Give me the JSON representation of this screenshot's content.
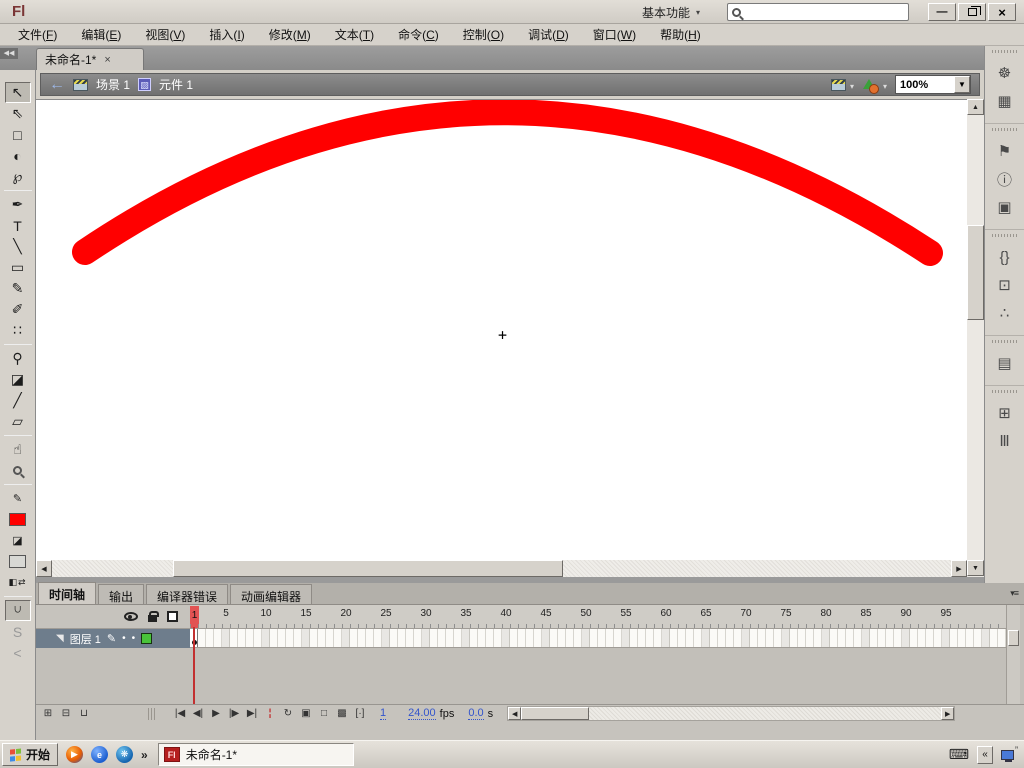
{
  "titlebar": {
    "logo": "Fl",
    "workspace": "基本功能",
    "dropdown_arrow": "▾",
    "search_value": "",
    "window_controls": {
      "minimize": "—",
      "close": "×"
    }
  },
  "menu": {
    "items": [
      {
        "label": "文件",
        "mnemonic": "F"
      },
      {
        "label": "编辑",
        "mnemonic": "E"
      },
      {
        "label": "视图",
        "mnemonic": "V"
      },
      {
        "label": "插入",
        "mnemonic": "I"
      },
      {
        "label": "修改",
        "mnemonic": "M"
      },
      {
        "label": "文本",
        "mnemonic": "T"
      },
      {
        "label": "命令",
        "mnemonic": "C"
      },
      {
        "label": "控制",
        "mnemonic": "O"
      },
      {
        "label": "调试",
        "mnemonic": "D"
      },
      {
        "label": "窗口",
        "mnemonic": "W"
      },
      {
        "label": "帮助",
        "mnemonic": "H"
      }
    ]
  },
  "doc_tab": {
    "label": "未命名-1*",
    "close": "×",
    "collapse": "◀◀"
  },
  "edit_bar": {
    "back_arrow": "←",
    "scene_label": "场景 1",
    "symbol_label": "元件 1",
    "zoom_value": "100%",
    "zoom_dropdown": "▼"
  },
  "toolbar": {
    "tools": [
      {
        "name": "selection-tool",
        "glyph": "↖",
        "selected": true
      },
      {
        "name": "subselection-tool",
        "glyph": "⇖"
      },
      {
        "name": "free-transform-tool",
        "glyph": "□"
      },
      {
        "name": "3d-rotation-tool",
        "glyph": "◐"
      },
      {
        "name": "lasso-tool",
        "glyph": "℘"
      },
      {
        "type": "divider"
      },
      {
        "name": "pen-tool",
        "glyph": "✒"
      },
      {
        "name": "text-tool",
        "glyph": "T"
      },
      {
        "name": "line-tool",
        "glyph": "╲"
      },
      {
        "name": "rectangle-tool",
        "glyph": "▭"
      },
      {
        "name": "pencil-tool",
        "glyph": "✎"
      },
      {
        "name": "brush-tool",
        "glyph": "✐"
      },
      {
        "name": "spray-brush-tool",
        "glyph": "∷"
      },
      {
        "type": "divider"
      },
      {
        "name": "bone-tool",
        "glyph": "⚲"
      },
      {
        "name": "paint-bucket-tool",
        "glyph": "◪"
      },
      {
        "name": "eyedropper-tool",
        "glyph": "╱"
      },
      {
        "name": "eraser-tool",
        "glyph": "▱"
      },
      {
        "type": "divider"
      },
      {
        "name": "hand-tool",
        "glyph": "☝"
      },
      {
        "name": "zoom-tool",
        "type": "magnifier"
      },
      {
        "type": "divider"
      },
      {
        "name": "stroke-color-icon",
        "glyph": "✎",
        "small": true
      },
      {
        "name": "stroke-color-swatch",
        "type": "swatch",
        "color": "#ff0000"
      },
      {
        "name": "fill-color-icon",
        "glyph": "◪",
        "small": true
      },
      {
        "name": "fill-color-swatch",
        "type": "swatch",
        "color": "#d8d8d4"
      },
      {
        "name": "black-white-swap",
        "type": "bw-swap"
      },
      {
        "type": "divider"
      },
      {
        "name": "snap-to-objects-toggle",
        "glyph": "∩",
        "magnet": true,
        "selected": true
      },
      {
        "name": "smooth-option",
        "glyph": "S",
        "disabled": true
      },
      {
        "name": "straighten-option",
        "glyph": "<",
        "disabled": true
      }
    ]
  },
  "right_strip": {
    "groups": [
      {
        "icons": [
          {
            "name": "color-panel-icon",
            "glyph": "☸"
          },
          {
            "name": "swatches-panel-icon",
            "glyph": "▦"
          }
        ]
      },
      {
        "icons": [
          {
            "name": "align-panel-icon",
            "glyph": "⚑"
          },
          {
            "name": "info-panel-icon",
            "glyph": "ⓘ"
          },
          {
            "name": "transform-panel-icon",
            "glyph": "▣"
          }
        ]
      },
      {
        "icons": [
          {
            "name": "code-snippets-panel-icon",
            "glyph": "{}"
          },
          {
            "name": "components-panel-icon",
            "glyph": "⊡"
          },
          {
            "name": "motion-presets-panel-icon",
            "glyph": "∴"
          }
        ]
      },
      {
        "icons": [
          {
            "name": "project-panel-icon",
            "glyph": "▤"
          }
        ]
      },
      {
        "icons": [
          {
            "name": "component-inspector-panel-icon",
            "glyph": "⊞"
          },
          {
            "name": "library-panel-icon",
            "glyph": "Ⅲ"
          }
        ]
      }
    ]
  },
  "canvas": {
    "stroke_color": "#ff0000",
    "crosshair": "+"
  },
  "timeline": {
    "tabs": [
      {
        "label": "时间轴",
        "active": true
      },
      {
        "label": "输出",
        "active": false
      },
      {
        "label": "编译器错误",
        "active": false
      },
      {
        "label": "动画编辑器",
        "active": false
      }
    ],
    "panel_menu_icon": "▾≡",
    "current_frame": "1",
    "ruler_numbers": [
      5,
      10,
      15,
      20,
      25,
      30,
      35,
      40,
      45,
      50,
      55,
      60,
      65,
      70,
      75,
      80,
      85,
      90,
      95
    ],
    "layer": {
      "name": "图层 1",
      "outline_color": "#49c43a",
      "pencil": "✎",
      "corner": "◥",
      "dot": "•"
    },
    "controls": {
      "left_buttons": [
        {
          "name": "new-layer-button",
          "glyph": "⊞"
        },
        {
          "name": "new-folder-button",
          "glyph": "⊟"
        },
        {
          "name": "delete-layer-button",
          "glyph": "⊔"
        }
      ],
      "playback": [
        {
          "name": "first-frame-button",
          "glyph": "|◀"
        },
        {
          "name": "prev-frame-button",
          "glyph": "◀|"
        },
        {
          "name": "play-button",
          "glyph": "▶"
        },
        {
          "name": "next-frame-button",
          "glyph": "|▶"
        },
        {
          "name": "last-frame-button",
          "glyph": "▶|"
        }
      ],
      "marker_buttons": [
        {
          "name": "center-frame-button",
          "glyph": "¦",
          "red": true
        },
        {
          "name": "loop-button",
          "glyph": "↻"
        }
      ],
      "onion_buttons": [
        {
          "name": "onion-skin-button",
          "glyph": "▣"
        },
        {
          "name": "onion-skin-outlines-button",
          "glyph": "□"
        },
        {
          "name": "edit-multiple-frames-button",
          "glyph": "▩"
        },
        {
          "name": "modify-markers-button",
          "glyph": "[·]"
        }
      ],
      "frame": "1",
      "fps": "24.00",
      "fps_unit": "fps",
      "elapsed": "0.0",
      "elapsed_unit": "s"
    }
  },
  "taskbar": {
    "start_label": "开始",
    "overflow": "»",
    "app": {
      "icon": "Fl",
      "label": "未命名-1*"
    },
    "tray": {
      "keyboard": "⌨",
      "collapse": "«"
    },
    "flag_colors": [
      "#e8503a",
      "#7ebe3c",
      "#3c8be8",
      "#f0c030"
    ]
  }
}
